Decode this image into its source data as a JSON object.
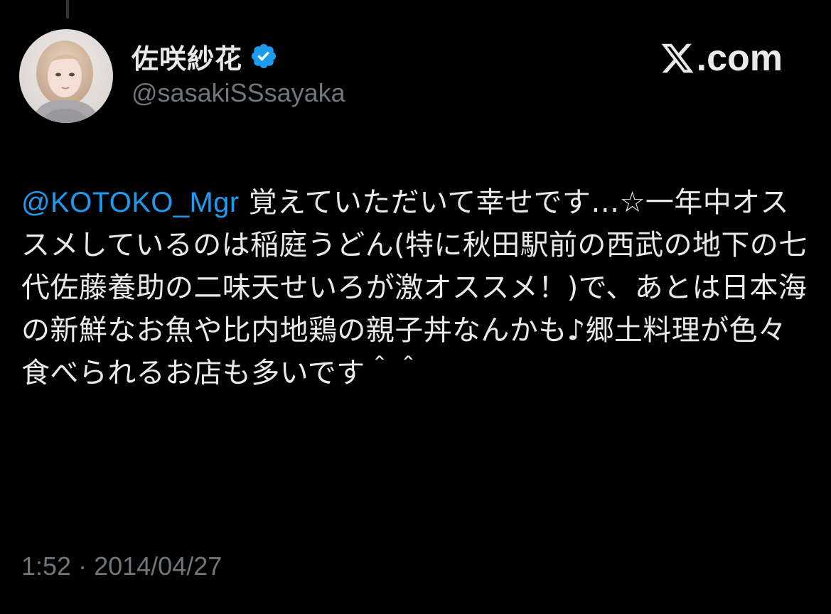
{
  "brand": {
    "label": ".com",
    "icon": "x-logo-icon"
  },
  "author": {
    "display_name": "佐咲紗花",
    "handle": "@sasakiSSsayaka",
    "verified_icon": "verified-badge-icon",
    "avatar_icon": "profile-avatar"
  },
  "tweet": {
    "mention": "@KOTOKO_Mgr",
    "body": " 覚えていただいて幸せです…☆一年中オススメしているのは稲庭うどん(特に秋田駅前の西武の地下の七代佐藤養助の二味天せいろが激オススメ！)で、あとは日本海の新鮮なお魚や比内地鶏の親子丼なんかも♪郷土料理が色々食べられるお店も多いです＾＾"
  },
  "meta": {
    "time": "1:52",
    "separator": " · ",
    "date": "2014/04/27"
  },
  "colors": {
    "background": "#000000",
    "text": "#e7e9ea",
    "secondary": "#71767b",
    "accent": "#1d9bf0"
  }
}
